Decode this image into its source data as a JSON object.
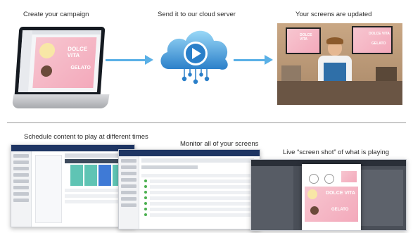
{
  "captions": {
    "create": "Create your campaign",
    "send": "Send it to our cloud server",
    "updated": "Your screens are updated",
    "schedule": "Schedule content to play at different times",
    "monitor": "Monitor all of your screens",
    "live": "Live “screen shot” of what is playing"
  },
  "promo": {
    "headline": "DOLCE VITA",
    "brand": "GELATO"
  },
  "icons": {
    "cloud": "cloud-play-icon",
    "arrow": "right-arrow-icon",
    "play": "play-icon"
  },
  "colors": {
    "arrow": "#5ab0e6",
    "cloud_light": "#8fd0f5",
    "cloud_dark": "#2a7fc9",
    "app_header": "#1e3563",
    "promo_pink": "#f3a9bb",
    "schedule_teal": "#5fc4b4",
    "schedule_blue": "#3f7ad6"
  }
}
